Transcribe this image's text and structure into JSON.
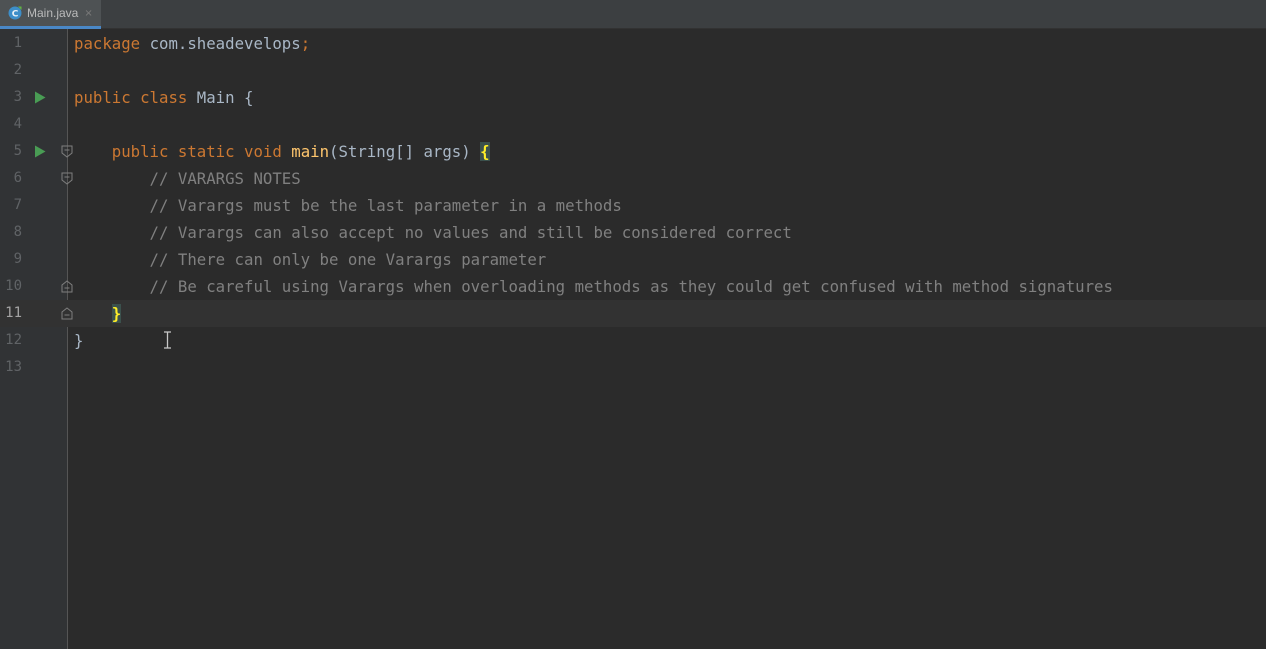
{
  "tab": {
    "filename": "Main.java",
    "close_glyph": "×"
  },
  "editor": {
    "lines": [
      {
        "number": "1",
        "tokens": [
          {
            "text": "package",
            "class": "kw"
          },
          {
            "text": " com.sheadevelops",
            "class": ""
          },
          {
            "text": ";",
            "class": "kw"
          }
        ]
      },
      {
        "number": "2",
        "tokens": []
      },
      {
        "number": "3",
        "run": true,
        "tokens": [
          {
            "text": "public class",
            "class": "kw"
          },
          {
            "text": " Main {",
            "class": ""
          }
        ]
      },
      {
        "number": "4",
        "tokens": []
      },
      {
        "number": "5",
        "run": true,
        "fold": "open",
        "tokens": [
          {
            "text": "    ",
            "class": ""
          },
          {
            "text": "public static void",
            "class": "kw"
          },
          {
            "text": " ",
            "class": ""
          },
          {
            "text": "main",
            "class": "fn"
          },
          {
            "text": "(String[] args) ",
            "class": ""
          },
          {
            "text": "{",
            "class": "match"
          }
        ]
      },
      {
        "number": "6",
        "fold": "open",
        "tokens": [
          {
            "text": "        // VARARGS NOTES",
            "class": "cm"
          }
        ]
      },
      {
        "number": "7",
        "tokens": [
          {
            "text": "        // Varargs must be the last parameter in a methods",
            "class": "cm"
          }
        ]
      },
      {
        "number": "8",
        "tokens": [
          {
            "text": "        // Varargs can also accept no values and still be considered correct",
            "class": "cm"
          }
        ]
      },
      {
        "number": "9",
        "tokens": [
          {
            "text": "        // There can only be one Varargs parameter",
            "class": "cm"
          }
        ]
      },
      {
        "number": "10",
        "fold": "close",
        "tokens": [
          {
            "text": "        // Be careful using Varargs when overloading methods as they could get confused with method signatures",
            "class": "cm"
          }
        ]
      },
      {
        "number": "11",
        "current": true,
        "fold": "close",
        "tokens": [
          {
            "text": "    ",
            "class": ""
          },
          {
            "text": "}",
            "class": "match"
          }
        ]
      },
      {
        "number": "12",
        "tokens": [
          {
            "text": "}",
            "class": ""
          }
        ]
      },
      {
        "number": "13",
        "tokens": []
      }
    ]
  },
  "icons": {
    "file": "java-class-icon",
    "run": "run-arrow-icon",
    "fold": "fold-marker-icon",
    "caret": "text-cursor-icon"
  },
  "colors": {
    "background": "#2b2b2b",
    "gutter": "#313335",
    "keyword": "#cc7832",
    "function": "#ffc66d",
    "comment": "#808080",
    "text": "#a9b7c6",
    "run": "#499c54",
    "tab_underline": "#4a88c7"
  }
}
